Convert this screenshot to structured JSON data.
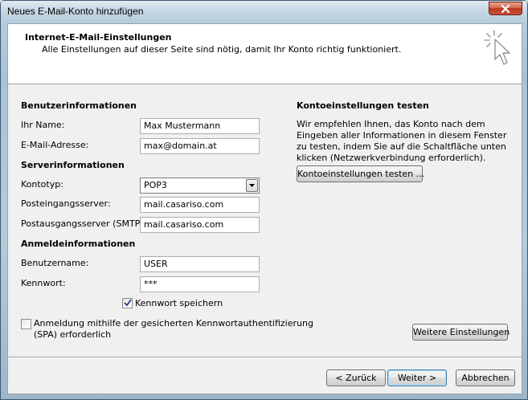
{
  "window": {
    "title": "Neues E-Mail-Konto hinzufügen"
  },
  "header": {
    "title": "Internet-E-Mail-Einstellungen",
    "subtitle": "Alle Einstellungen auf dieser Seite sind nötig, damit Ihr Konto richtig funktioniert."
  },
  "user_info": {
    "heading": "Benutzerinformationen",
    "name_label": "Ihr Name:",
    "name_value": "Max Mustermann",
    "email_label": "E-Mail-Adresse:",
    "email_value": "max@domain.at"
  },
  "server_info": {
    "heading": "Serverinformationen",
    "account_type_label": "Kontotyp:",
    "account_type_value": "POP3",
    "incoming_label": "Posteingangsserver:",
    "incoming_value": "mail.casariso.com",
    "outgoing_label": "Postausgangsserver (SMTP):",
    "outgoing_value": "mail.casariso.com"
  },
  "login_info": {
    "heading": "Anmeldeinformationen",
    "username_label": "Benutzername:",
    "username_value": "USER",
    "password_label": "Kennwort:",
    "password_value": "***",
    "remember_label": "Kennwort speichern",
    "remember_checked": true,
    "spa_label_line1": "Anmeldung mithilfe der gesicherten Kennwortauthentifizierung",
    "spa_label_line2": "(SPA) erforderlich",
    "spa_checked": false
  },
  "test_panel": {
    "heading": "Kontoeinstellungen testen",
    "description": "Wir empfehlen Ihnen, das Konto nach dem Eingeben aller Informationen in diesem Fenster zu testen, indem Sie auf die Schaltfläche unten klicken (Netzwerkverbindung erforderlich).",
    "test_button": "Kontoeinstellungen testen ..."
  },
  "more_settings_button": "Weitere Einstellungen",
  "footer": {
    "back_button": "< Zurück",
    "next_button": "Weiter >",
    "cancel_button": "Abbrechen"
  },
  "colors": {
    "dialog_bg": "#f0f0f0",
    "header_bg": "#ffffff",
    "close_button": "#c9553a",
    "default_button_border": "#3c7fb1"
  },
  "icons": {
    "close": "close-icon",
    "wizard": "cursor-sparkle-icon",
    "dropdown": "chevron-down-icon",
    "check": "checkmark-icon"
  }
}
